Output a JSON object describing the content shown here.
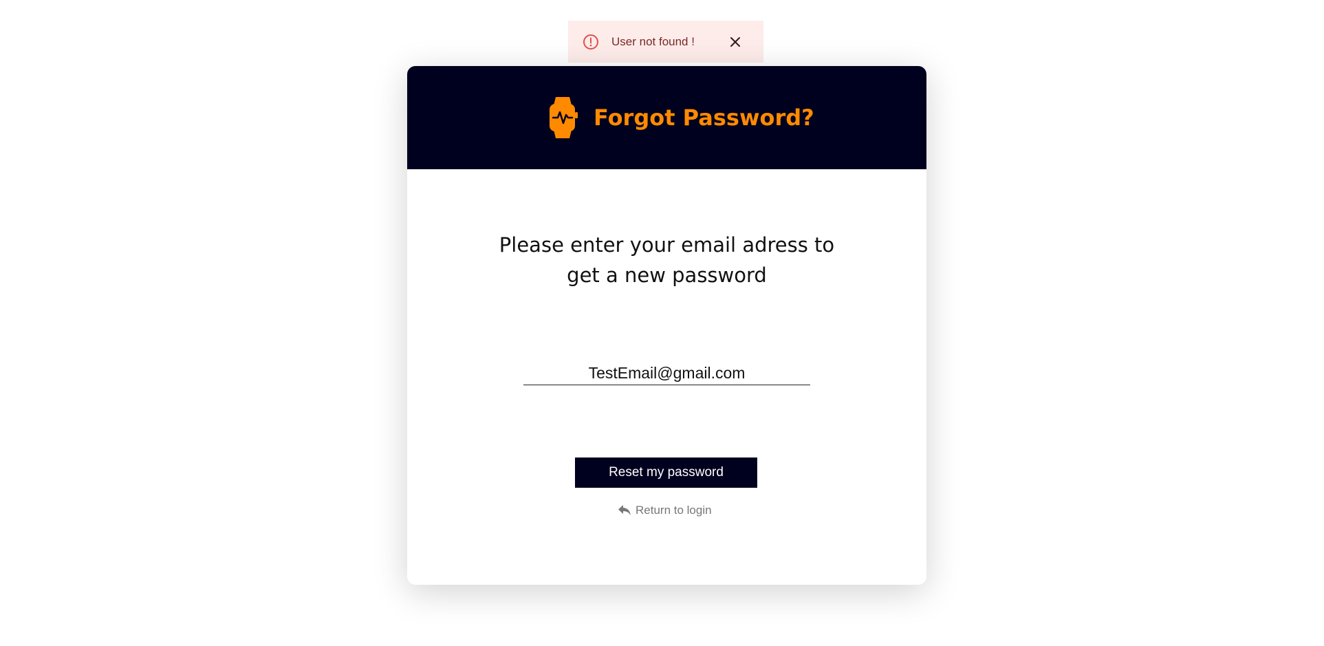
{
  "toast": {
    "message": "User not found !",
    "icon": "alert-circle-icon",
    "close_icon": "close-icon",
    "accent_color": "#e0504a",
    "background_color": "#fdecea"
  },
  "header": {
    "logo_icon": "smartwatch-icon",
    "title": "Forgot Password?",
    "background_color": "#00001f",
    "accent_color": "#ff8a00"
  },
  "form": {
    "instruction_line1": "Please enter your email adress to",
    "instruction_line2": "get a new password",
    "email_value": "TestEmail@gmail.com",
    "submit_label": "Reset my password",
    "return_label": "Return to login",
    "return_icon": "reply-arrow-icon"
  }
}
